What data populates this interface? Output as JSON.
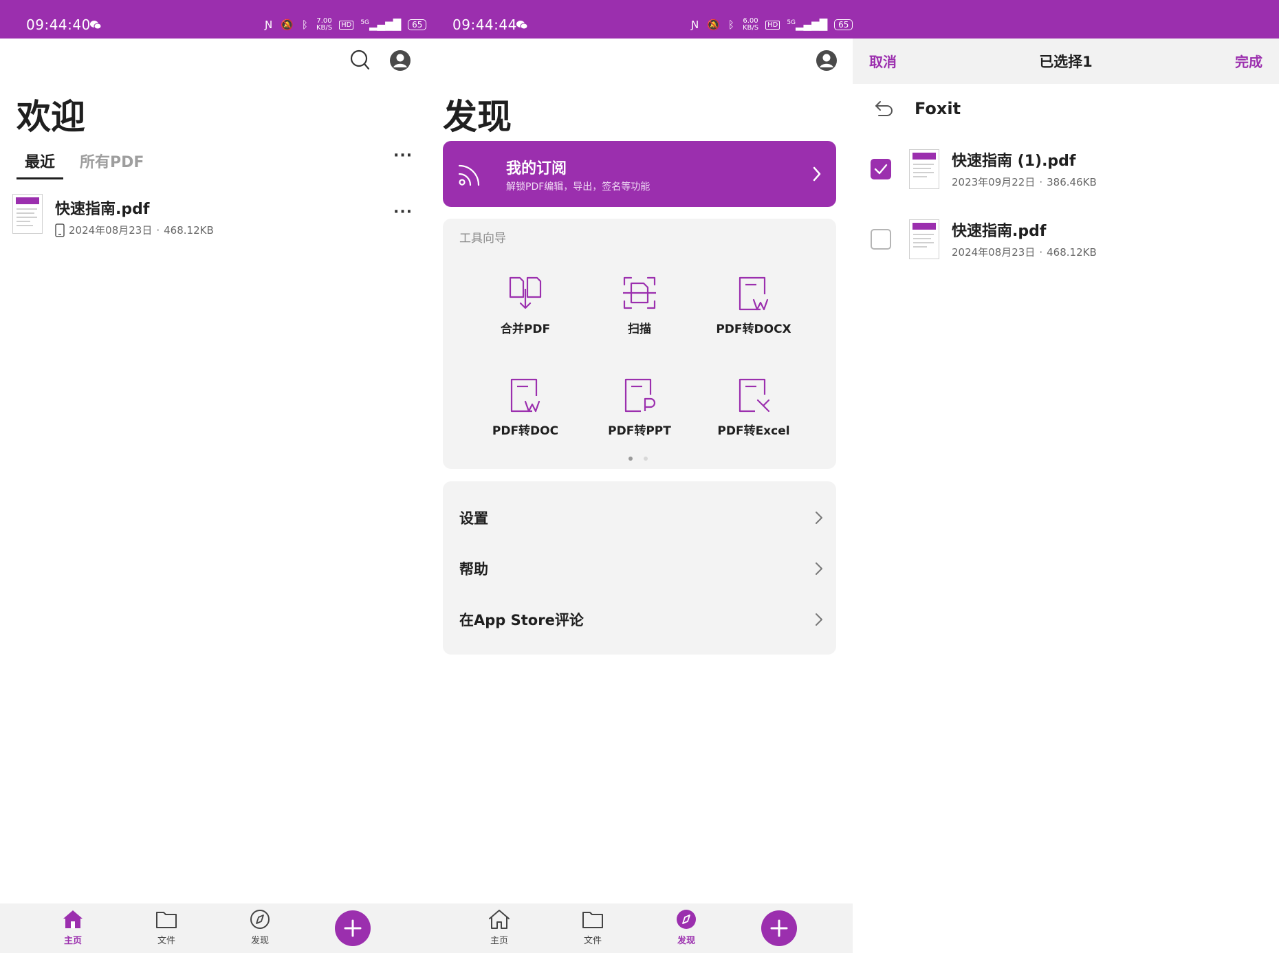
{
  "status_bars": [
    {
      "time": "09:44:40",
      "speed_top": "7.00",
      "speed_unit": "KB/S",
      "network": "5G",
      "battery": "65"
    },
    {
      "time": "09:44:44",
      "speed_top": "6.00",
      "speed_unit": "KB/S",
      "network": "5G",
      "battery": "65"
    }
  ],
  "home": {
    "title": "欢迎",
    "tabs": [
      {
        "label": "最近",
        "active": true
      },
      {
        "label": "所有PDF",
        "active": false
      }
    ],
    "more": "···",
    "files": [
      {
        "name": "快速指南.pdf",
        "date": "2024年08月23日",
        "sep": "·",
        "size": "468.12KB",
        "device_icon": "phone-icon"
      }
    ]
  },
  "discover": {
    "title": "发现",
    "promo": {
      "title": "我的订阅",
      "subtitle": "解锁PDF编辑，导出，签名等功能"
    },
    "tools_title": "工具向导",
    "tools": [
      {
        "label": "合并PDF",
        "icon": "merge-pdf-icon"
      },
      {
        "label": "扫描",
        "icon": "scan-icon"
      },
      {
        "label": "PDF转DOCX",
        "icon": "pdf-to-docx-icon"
      },
      {
        "label": "PDF转DOC",
        "icon": "pdf-to-doc-icon"
      },
      {
        "label": "PDF转PPT",
        "icon": "pdf-to-ppt-icon"
      },
      {
        "label": "PDF转Excel",
        "icon": "pdf-to-excel-icon"
      }
    ],
    "menu": [
      {
        "label": "设置"
      },
      {
        "label": "帮助"
      },
      {
        "label": "在App Store评论"
      }
    ]
  },
  "select": {
    "cancel": "取消",
    "title": "已选择1",
    "done": "完成",
    "folder": "Foxit",
    "files": [
      {
        "name": "快速指南 (1).pdf",
        "date": "2023年09月22日",
        "sep": "·",
        "size": "386.46KB",
        "checked": true
      },
      {
        "name": "快速指南.pdf",
        "date": "2024年08月23日",
        "sep": "·",
        "size": "468.12KB",
        "checked": false
      }
    ]
  },
  "nav": {
    "home": "主页",
    "files": "文件",
    "discover": "发现"
  },
  "colors": {
    "accent": "#9b2fae",
    "bg_card": "#f3f3f3",
    "nav_bg": "#f2f2f2"
  }
}
